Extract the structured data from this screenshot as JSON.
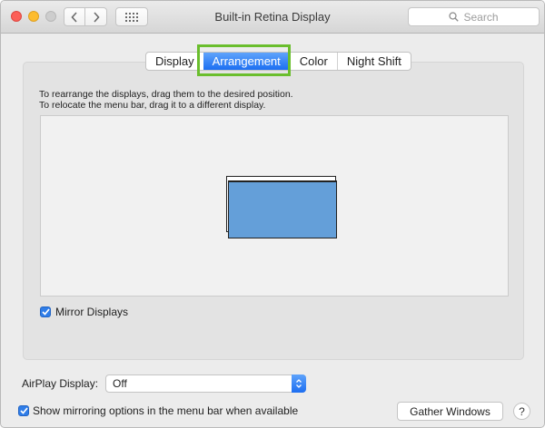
{
  "window": {
    "title": "Built-in Retina Display",
    "search_placeholder": "Search"
  },
  "icons": {
    "back": "chevron-left-icon",
    "forward": "chevron-right-icon",
    "grid": "grid-icon",
    "search": "search-icon",
    "check": "checkmark-icon",
    "stepper": "up-down-chevron-icon"
  },
  "tabs": [
    {
      "label": "Display",
      "active": false
    },
    {
      "label": "Arrangement",
      "active": true
    },
    {
      "label": "Color",
      "active": false
    },
    {
      "label": "Night Shift",
      "active": false
    }
  ],
  "arrangement": {
    "instruction_line1": "To rearrange the displays, drag them to the desired position.",
    "instruction_line2": "To relocate the menu bar, drag it to a different display.",
    "mirror_label": "Mirror Displays",
    "mirror_checked": true
  },
  "airplay": {
    "label": "AirPlay Display:",
    "selected": "Off"
  },
  "show_mirroring": {
    "label": "Show mirroring options in the menu bar when available",
    "checked": true
  },
  "buttons": {
    "gather": "Gather Windows",
    "help": "?"
  },
  "colors": {
    "accent": "#1c6ff2",
    "highlight_outline": "#6abe2d",
    "display_fill": "#649fd9"
  }
}
